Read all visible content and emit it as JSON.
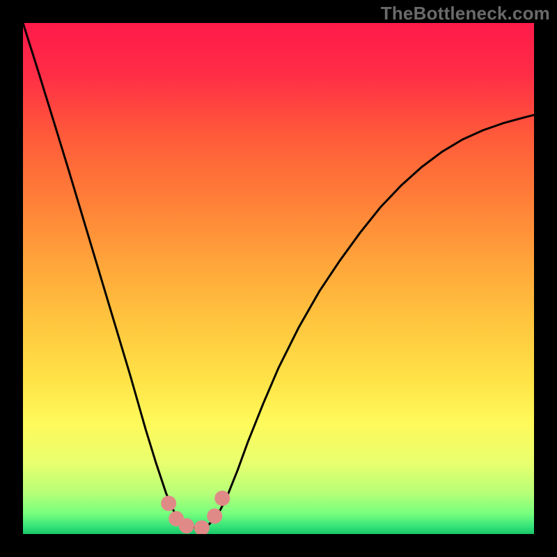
{
  "watermark": "TheBottleneck.com",
  "chart_data": {
    "type": "line",
    "title": "",
    "xlabel": "",
    "ylabel": "",
    "xlim": [
      0,
      1
    ],
    "ylim": [
      0,
      1
    ],
    "series": [
      {
        "name": "curve",
        "x": [
          0.0,
          0.03,
          0.06,
          0.09,
          0.12,
          0.15,
          0.18,
          0.21,
          0.24,
          0.26,
          0.28,
          0.295,
          0.31,
          0.325,
          0.34,
          0.36,
          0.38,
          0.4,
          0.42,
          0.44,
          0.47,
          0.5,
          0.54,
          0.58,
          0.62,
          0.66,
          0.7,
          0.74,
          0.78,
          0.82,
          0.86,
          0.9,
          0.94,
          0.98,
          1.0
        ],
        "y": [
          1.0,
          0.905,
          0.808,
          0.71,
          0.61,
          0.51,
          0.41,
          0.31,
          0.205,
          0.14,
          0.08,
          0.045,
          0.025,
          0.015,
          0.012,
          0.015,
          0.035,
          0.075,
          0.125,
          0.18,
          0.255,
          0.325,
          0.405,
          0.475,
          0.535,
          0.59,
          0.64,
          0.682,
          0.718,
          0.748,
          0.772,
          0.79,
          0.804,
          0.815,
          0.82
        ]
      }
    ],
    "markers": [
      {
        "x": 0.285,
        "y": 0.06
      },
      {
        "x": 0.3,
        "y": 0.03
      },
      {
        "x": 0.32,
        "y": 0.016
      },
      {
        "x": 0.35,
        "y": 0.012
      },
      {
        "x": 0.375,
        "y": 0.035
      },
      {
        "x": 0.39,
        "y": 0.07
      }
    ],
    "gradient_stops": [
      {
        "pos": 0.0,
        "color": "#ff1a4a"
      },
      {
        "pos": 0.1,
        "color": "#ff2d46"
      },
      {
        "pos": 0.22,
        "color": "#ff5a3a"
      },
      {
        "pos": 0.34,
        "color": "#ff7d38"
      },
      {
        "pos": 0.46,
        "color": "#ffa23a"
      },
      {
        "pos": 0.58,
        "color": "#ffc43e"
      },
      {
        "pos": 0.7,
        "color": "#ffe347"
      },
      {
        "pos": 0.78,
        "color": "#fff95a"
      },
      {
        "pos": 0.86,
        "color": "#e9ff6e"
      },
      {
        "pos": 0.92,
        "color": "#b6ff78"
      },
      {
        "pos": 0.96,
        "color": "#76ff7d"
      },
      {
        "pos": 0.985,
        "color": "#36e37a"
      },
      {
        "pos": 1.0,
        "color": "#18c768"
      }
    ],
    "marker_color": "#e08a88",
    "curve_color": "#000000"
  }
}
